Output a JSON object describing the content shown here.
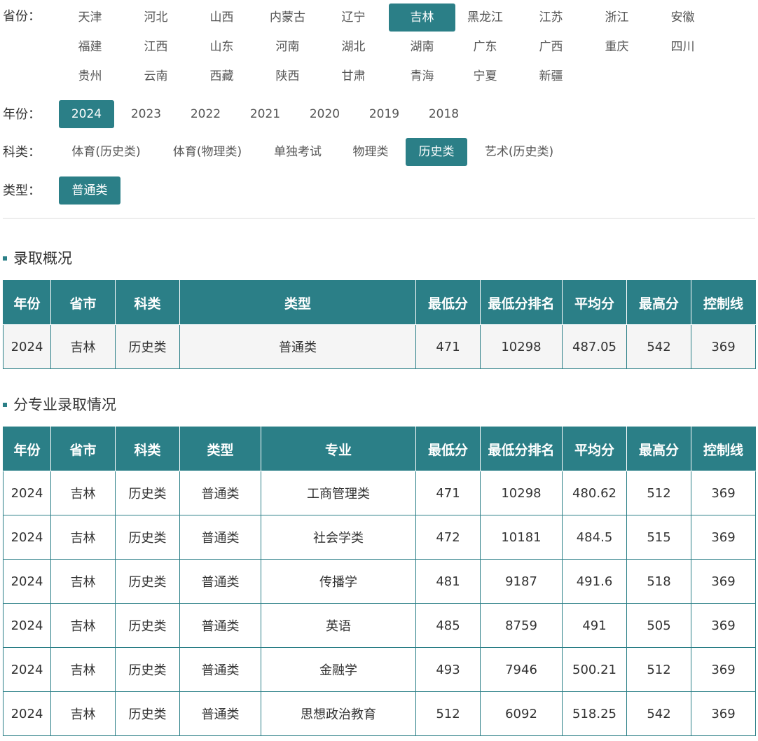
{
  "filters": {
    "province": {
      "label": "省份：",
      "options": [
        "天津",
        "河北",
        "山西",
        "内蒙古",
        "辽宁",
        "吉林",
        "黑龙江",
        "江苏",
        "浙江",
        "安徽",
        "福建",
        "江西",
        "山东",
        "河南",
        "湖北",
        "湖南",
        "广东",
        "广西",
        "重庆",
        "四川",
        "贵州",
        "云南",
        "西藏",
        "陕西",
        "甘肃",
        "青海",
        "宁夏",
        "新疆"
      ],
      "selected": "吉林"
    },
    "year": {
      "label": "年份：",
      "options": [
        "2024",
        "2023",
        "2022",
        "2021",
        "2020",
        "2019",
        "2018"
      ],
      "selected": "2024"
    },
    "subject": {
      "label": "科类：",
      "options": [
        "体育(历史类)",
        "体育(物理类)",
        "单独考试",
        "物理类",
        "历史类",
        "艺术(历史类)"
      ],
      "selected": "历史类"
    },
    "type": {
      "label": "类型：",
      "options": [
        "普通类"
      ],
      "selected": "普通类"
    }
  },
  "accent_color": "#2b7f87",
  "summary": {
    "title": "录取概况",
    "headers": [
      "年份",
      "省市",
      "科类",
      "类型",
      "最低分",
      "最低分排名",
      "平均分",
      "最高分",
      "控制线"
    ],
    "rows": [
      [
        "2024",
        "吉林",
        "历史类",
        "普通类",
        "471",
        "10298",
        "487.05",
        "542",
        "369"
      ]
    ]
  },
  "majors": {
    "title": "分专业录取情况",
    "headers": [
      "年份",
      "省市",
      "科类",
      "类型",
      "专业",
      "最低分",
      "最低分排名",
      "平均分",
      "最高分",
      "控制线"
    ],
    "rows": [
      [
        "2024",
        "吉林",
        "历史类",
        "普通类",
        "工商管理类",
        "471",
        "10298",
        "480.62",
        "512",
        "369"
      ],
      [
        "2024",
        "吉林",
        "历史类",
        "普通类",
        "社会学类",
        "472",
        "10181",
        "484.5",
        "515",
        "369"
      ],
      [
        "2024",
        "吉林",
        "历史类",
        "普通类",
        "传播学",
        "481",
        "9187",
        "491.6",
        "518",
        "369"
      ],
      [
        "2024",
        "吉林",
        "历史类",
        "普通类",
        "英语",
        "485",
        "8759",
        "491",
        "505",
        "369"
      ],
      [
        "2024",
        "吉林",
        "历史类",
        "普通类",
        "金融学",
        "493",
        "7946",
        "500.21",
        "512",
        "369"
      ],
      [
        "2024",
        "吉林",
        "历史类",
        "普通类",
        "思想政治教育",
        "512",
        "6092",
        "518.25",
        "542",
        "369"
      ]
    ]
  }
}
